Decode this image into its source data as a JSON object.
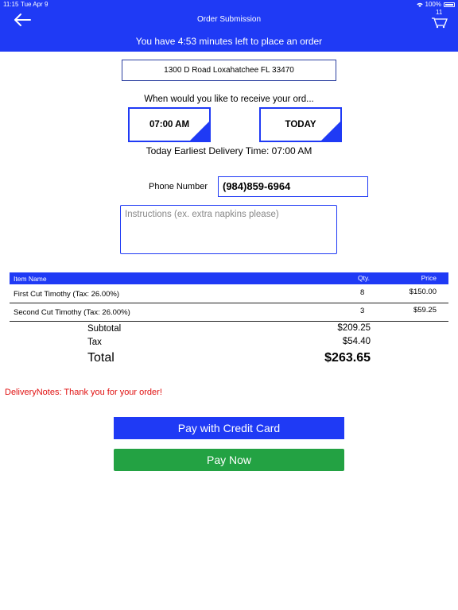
{
  "status_bar": {
    "time": "11:15",
    "day": "Tue Apr 9",
    "battery": "100%"
  },
  "header": {
    "title": "Order Submission",
    "cart_count": "11",
    "timer_text": "You have 4:53 minutes left to place an order"
  },
  "address": "1300 D Road Loxahatchee FL 33470",
  "receive_label": "When would you like to receive your ord...",
  "selectors": {
    "time": "07:00 AM",
    "day": "TODAY"
  },
  "earliest_delivery": "Today Earliest Delivery Time: 07:00 AM",
  "phone": {
    "label": "Phone Number",
    "value": "(984)859-6964"
  },
  "instructions": {
    "placeholder": "Instructions (ex. extra napkins please)"
  },
  "table": {
    "headers": {
      "name": "Item Name",
      "qty": "Qty.",
      "price": "Price"
    },
    "rows": [
      {
        "name": "First Cut Timothy (Tax: 26.00%)",
        "qty": "8",
        "price": "$150.00"
      },
      {
        "name": "Second Cut Timothy (Tax: 26.00%)",
        "qty": "3",
        "price": "$59.25"
      }
    ]
  },
  "summary": {
    "subtotal_label": "Subtotal",
    "subtotal": "$209.25",
    "tax_label": "Tax",
    "tax": "$54.40",
    "total_label": "Total",
    "total": "$263.65"
  },
  "delivery_notes": "DeliveryNotes: Thank you for your order!",
  "buttons": {
    "credit_card": "Pay with Credit Card",
    "pay_now": "Pay Now"
  },
  "colors": {
    "brand_blue": "#1f3af5",
    "pay_green": "#23a243",
    "notes_red": "#e01010"
  }
}
